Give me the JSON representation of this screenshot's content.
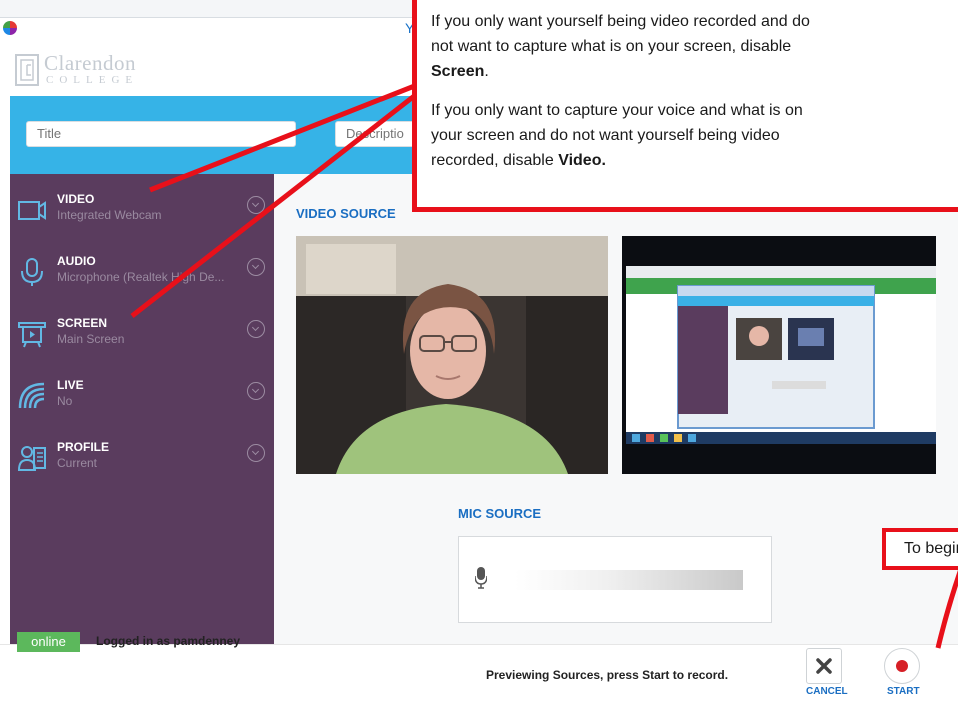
{
  "window": {
    "title": "Y"
  },
  "brand": {
    "name": "Clarendon",
    "sub": "COLLEGE"
  },
  "form": {
    "title_placeholder": "Title",
    "description_placeholder": "Description"
  },
  "sidebar": {
    "items": [
      {
        "title": "VIDEO",
        "subtitle": "Integrated Webcam",
        "icon": "camera-icon"
      },
      {
        "title": "AUDIO",
        "subtitle": "Microphone (Realtek High De...",
        "icon": "microphone-icon"
      },
      {
        "title": "SCREEN",
        "subtitle": "Main Screen",
        "icon": "screen-icon"
      },
      {
        "title": "LIVE",
        "subtitle": "No",
        "icon": "broadcast-icon"
      },
      {
        "title": "PROFILE",
        "subtitle": "Current",
        "icon": "profile-icon"
      }
    ]
  },
  "main": {
    "video_source_label": "VIDEO SOURCE",
    "mic_source_label": "MIC SOURCE"
  },
  "footer": {
    "status_badge": "online",
    "logged_in_text": "Logged in as pamdenney",
    "preview_text": "Previewing Sources, press Start to record.",
    "cancel_label": "CANCEL",
    "start_label": "START"
  },
  "annotation": {
    "line1": "If you only want yourself being video recorded and do",
    "line2": "not want to capture what is on your screen, disable",
    "line3": "Screen",
    "line4": "If you only want to capture your voice and what is on",
    "line5": "your screen and do not want yourself being video",
    "line6": "recorded, disable ",
    "line6_bold": "Video.",
    "begin_text": "To begin"
  },
  "colors": {
    "sidebar_bg": "#5a3c5e",
    "accent_blue": "#36b3e7",
    "online_green": "#5cb85c",
    "annotation_red": "#e8101a",
    "record_red": "#d61f26"
  }
}
